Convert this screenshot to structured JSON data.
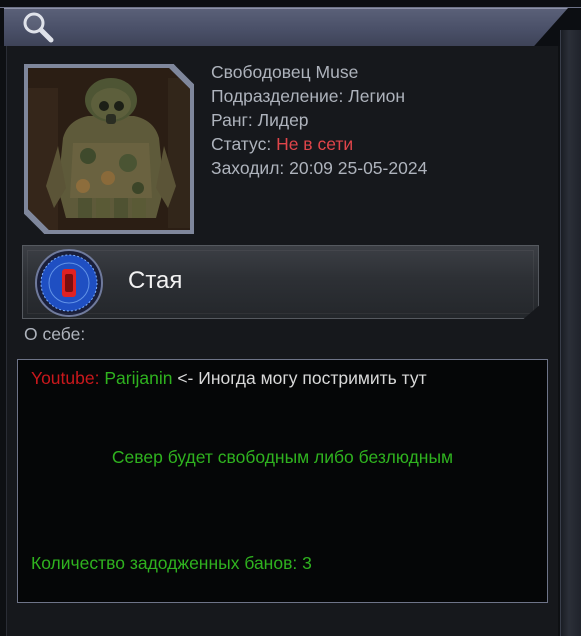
{
  "header": {
    "icon": "search-icon"
  },
  "profile": {
    "name_line": "Свободовец Muse",
    "division": "Подразделение: Легион",
    "rank": "Ранг: Лидер",
    "status_label": "Статус:",
    "status_value": "Не в сети",
    "last_seen": "Заходил: 20:09 25-05-2024",
    "avatar_icon": "avatar"
  },
  "clan": {
    "name": "Стая",
    "emblem_icon": "clan-emblem-icon"
  },
  "about": {
    "label": "О себе:",
    "youtube_label": "Youtube:",
    "youtube_channel": "Parijanin",
    "youtube_note": "<- Иногда могу постримить тут",
    "motto": "Север будет свободным либо безлюдным",
    "bans": "Количество задодженных банов: 3"
  },
  "colors": {
    "offline": "#e0454a",
    "green_text": "#2fb21f",
    "red_text": "#c9181c",
    "header_bar": "#4a5068"
  }
}
